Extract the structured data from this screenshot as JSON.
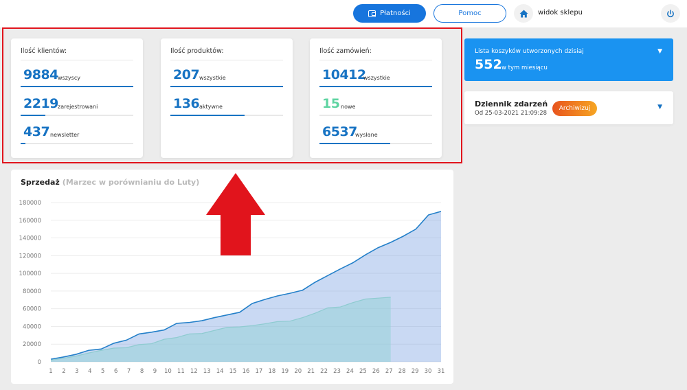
{
  "header": {
    "payments_label": "Płatności",
    "help_label": "Pomoc",
    "shop_view_label": "widok sklepu"
  },
  "stats": {
    "clients": {
      "title": "Ilość klientów:",
      "rows": [
        {
          "value": "9884",
          "label": "wszyscy",
          "progress": 1.0
        },
        {
          "value": "2219",
          "label": "zarejestrowani",
          "progress": 0.22
        },
        {
          "value": "437",
          "label": "newsletter",
          "progress": 0.04
        }
      ]
    },
    "products": {
      "title": "Ilość produktów:",
      "rows": [
        {
          "value": "207",
          "label": "wszystkie",
          "progress": 1.0
        },
        {
          "value": "136",
          "label": "aktywne",
          "progress": 0.66
        }
      ]
    },
    "orders": {
      "title": "Ilość zamówień:",
      "rows": [
        {
          "value": "10412",
          "label": "wszystkie",
          "progress": 1.0
        },
        {
          "value": "15",
          "label": "nowe",
          "progress": 0.0
        },
        {
          "value": "6537",
          "label": "wysłane",
          "progress": 0.63
        }
      ]
    }
  },
  "carts": {
    "title": "Lista koszyków utworzonych dzisiaj",
    "count": "552",
    "subtitle": "w tym miesiącu"
  },
  "event_log": {
    "title": "Dziennik zdarzeń",
    "date": "Od 25-03-2021 21:09:28",
    "archive_label": "Archiwizuj"
  },
  "sales": {
    "title": "Sprzedaż",
    "subtitle": "(Marzec w porównianiu do Luty)"
  },
  "colors": {
    "primary": "#1773c3",
    "accent": "#1a93f1",
    "green": "#5fd4a2",
    "arrow": "#e1141c"
  },
  "chart_data": {
    "type": "area",
    "x": [
      1,
      2,
      3,
      4,
      5,
      6,
      7,
      8,
      9,
      10,
      11,
      12,
      13,
      14,
      15,
      16,
      17,
      18,
      19,
      20,
      21,
      22,
      23,
      24,
      25,
      26,
      27,
      28,
      29,
      30,
      31
    ],
    "ylim": [
      0,
      180000
    ],
    "yticks": [
      0,
      20000,
      40000,
      60000,
      80000,
      100000,
      120000,
      140000,
      160000,
      180000
    ],
    "series": [
      {
        "values": [
          3000,
          5500,
          8500,
          13000,
          14500,
          21000,
          24500,
          31500,
          33500,
          36000,
          43500,
          44500,
          46500,
          50000,
          53000,
          56000,
          66000,
          70500,
          74500,
          77500,
          81000,
          90000,
          97500,
          105000,
          112000,
          121000,
          129000,
          135000,
          142000,
          150000,
          166000,
          170000
        ]
      },
      {
        "values": [
          2000,
          4000,
          6500,
          10000,
          13000,
          15500,
          16000,
          19500,
          20500,
          25500,
          27500,
          31500,
          32000,
          35500,
          39000,
          39500,
          41000,
          43000,
          45500,
          46000,
          50000,
          55000,
          61000,
          62000,
          67000,
          71000,
          72000,
          73000
        ]
      }
    ]
  }
}
